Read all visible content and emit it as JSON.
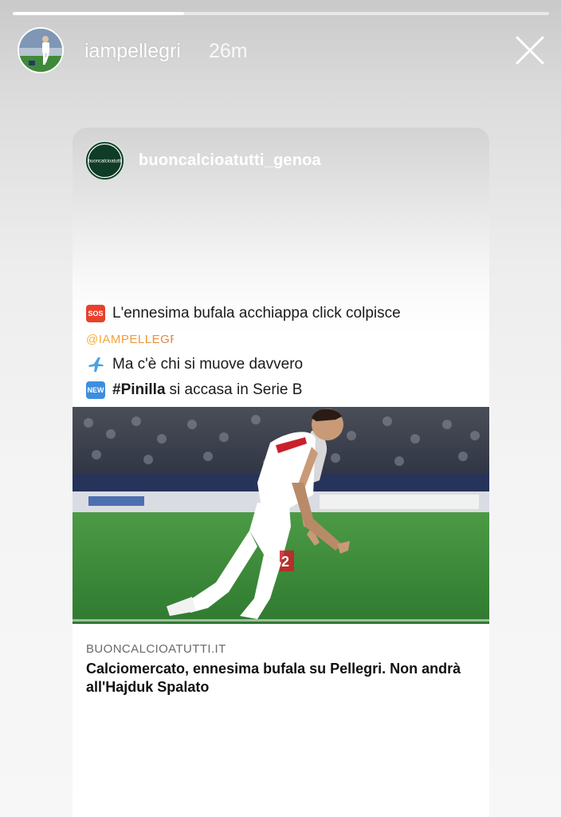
{
  "story": {
    "progress": 0.32,
    "username": "iampellegri",
    "time": "26m",
    "avatar_name": "profile-photo"
  },
  "post": {
    "username": "buoncalcioatutti_genoa",
    "avatar_text": "buoncalcioatutti",
    "caption": {
      "line1_badge": "SOS",
      "line1": "L'ennesima bufala acchiappa click colpisce",
      "mention": "@IAMPELLEGRI",
      "line3": "Ma c'è chi si muove davvero",
      "line4_badge": "NEW",
      "line4_hashtag": "#Pinilla",
      "line4": "si accasa in Serie B"
    },
    "photo": {
      "shirt_number": "2"
    },
    "link": {
      "domain": "BUONCALCIOATUTTI.IT",
      "title": "Calciomercato, ennesima bufala su Pellegri. Non andrà all'Hajduk Spalato"
    }
  },
  "colors": {
    "sos_badge": "#e8402c",
    "new_badge": "#3c8ee0",
    "mention_gradient": [
      "#f6b53c",
      "#e87a3a"
    ],
    "card_avatar_bg": "#0f3c26",
    "pitch": "#3f8b3c"
  },
  "icons": [
    "close-icon",
    "airplane-icon",
    "sos-icon",
    "new-icon"
  ]
}
